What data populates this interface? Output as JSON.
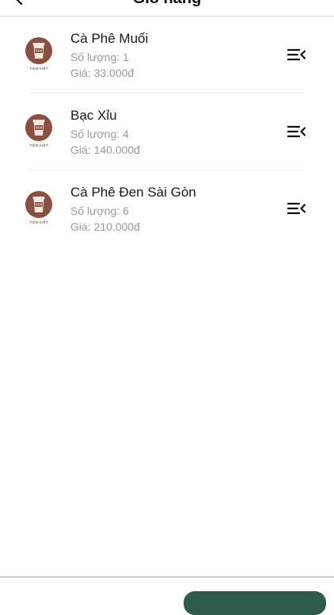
{
  "header": {
    "title": "Giỏ hàng"
  },
  "cart": {
    "items": [
      {
        "name": "Cà Phê Muối",
        "quantity": "Số lượng: 1",
        "price": "Giá: 33.000đ",
        "thumb_caption": "TIỆM KIẾT"
      },
      {
        "name": "Bạc Xỉu",
        "quantity": "Số lượng: 4",
        "price": "Giá: 140.000đ",
        "thumb_caption": "TIỆM KIẾT"
      },
      {
        "name": "Cà Phê Đen Sài Gòn",
        "quantity": "Số lượng: 6",
        "price": "Giá: 210.000đ",
        "thumb_caption": "TIỆM KIẾT"
      }
    ]
  },
  "icons": {
    "back": "chevron-left-icon",
    "item_menu": "list-collapse-icon",
    "thumbnail": "coffee-shop-logo-icon"
  },
  "colors": {
    "thumbnail_brown": "#8a4f3d",
    "muted_text": "#9a9a9a",
    "checkout_button": "#2f5b4e"
  }
}
